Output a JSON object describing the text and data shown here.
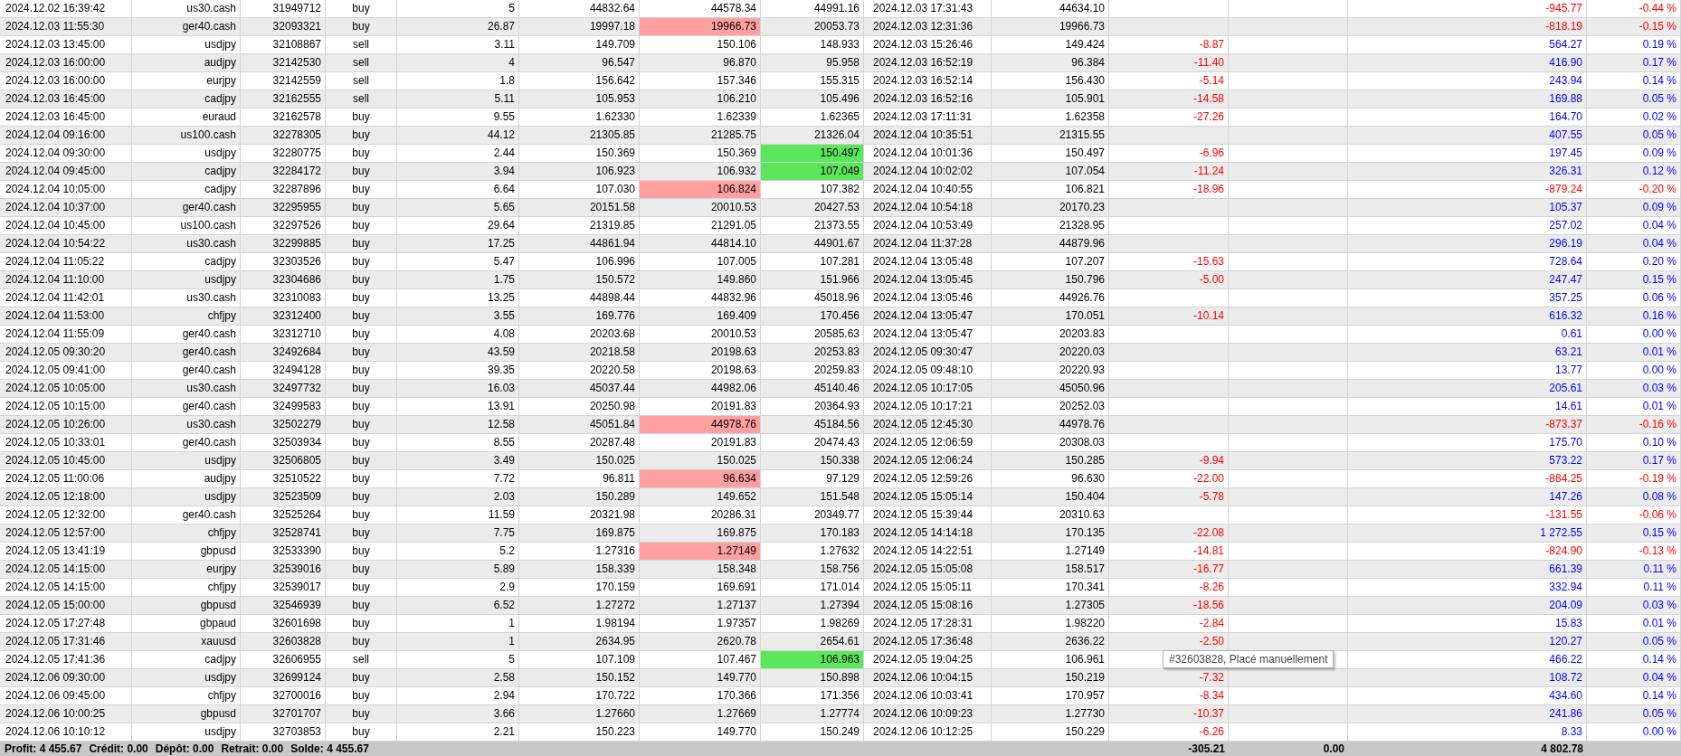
{
  "rows": [
    {
      "time": "2024.12.02 16:39:42",
      "symbol": "us30.cash",
      "ticket": "31949712",
      "type": "buy",
      "volume": "5",
      "price": "44832.64",
      "sl": "44578.34",
      "tp": "44991.16",
      "close_time": "2024.12.03 17:31:43",
      "close_price": "44634.10",
      "profit": "-945.77",
      "percent": "-0.44 %",
      "sl_hit": false,
      "tp_hit": false,
      "loss": true
    },
    {
      "time": "2024.12.03 11:55:30",
      "symbol": "ger40.cash",
      "ticket": "32093321",
      "type": "buy",
      "volume": "26.87",
      "price": "19997.18",
      "sl": "19966.73",
      "tp": "20053.73",
      "close_time": "2024.12.03 12:31:36",
      "close_price": "19966.73",
      "profit": "-818.19",
      "percent": "-0.15 %",
      "sl_hit": true,
      "tp_hit": false,
      "loss": true
    },
    {
      "time": "2024.12.03 13:45:00",
      "symbol": "usdjpy",
      "ticket": "32108867",
      "type": "sell",
      "volume": "3.11",
      "price": "149.709",
      "sl": "150.106",
      "tp": "148.933",
      "close_time": "2024.12.03 15:26:46",
      "close_price": "149.424",
      "commission": "-8.87",
      "profit": "564.27",
      "percent": "0.19 %",
      "sl_hit": false,
      "tp_hit": false,
      "loss": false
    },
    {
      "time": "2024.12.03 16:00:00",
      "symbol": "audjpy",
      "ticket": "32142530",
      "type": "sell",
      "volume": "4",
      "price": "96.547",
      "sl": "96.870",
      "tp": "95.958",
      "close_time": "2024.12.03 16:52:19",
      "close_price": "96.384",
      "commission": "-11.40",
      "profit": "416.90",
      "percent": "0.17 %",
      "sl_hit": false,
      "tp_hit": false,
      "loss": false
    },
    {
      "time": "2024.12.03 16:00:00",
      "symbol": "eurjpy",
      "ticket": "32142559",
      "type": "sell",
      "volume": "1.8",
      "price": "156.642",
      "sl": "157.346",
      "tp": "155.315",
      "close_time": "2024.12.03 16:52:14",
      "close_price": "156.430",
      "commission": "-5.14",
      "profit": "243.94",
      "percent": "0.14 %",
      "sl_hit": false,
      "tp_hit": false,
      "loss": false
    },
    {
      "time": "2024.12.03 16:45:00",
      "symbol": "cadjpy",
      "ticket": "32162555",
      "type": "sell",
      "volume": "5.11",
      "price": "105.953",
      "sl": "106.210",
      "tp": "105.496",
      "close_time": "2024.12.03 16:52:16",
      "close_price": "105.901",
      "commission": "-14.58",
      "profit": "169.88",
      "percent": "0.05 %",
      "sl_hit": false,
      "tp_hit": false,
      "loss": false
    },
    {
      "time": "2024.12.03 16:45:00",
      "symbol": "euraud",
      "ticket": "32162578",
      "type": "buy",
      "volume": "9.55",
      "price": "1.62330",
      "sl": "1.62339",
      "tp": "1.62365",
      "close_time": "2024.12.03 17:11:31",
      "close_price": "1.62358",
      "commission": "-27.26",
      "profit": "164.70",
      "percent": "0.02 %",
      "sl_hit": false,
      "tp_hit": false,
      "loss": false
    },
    {
      "time": "2024.12.04 09:16:00",
      "symbol": "us100.cash",
      "ticket": "32278305",
      "type": "buy",
      "volume": "44.12",
      "price": "21305.85",
      "sl": "21285.75",
      "tp": "21326.04",
      "close_time": "2024.12.04 10:35:51",
      "close_price": "21315.55",
      "profit": "407.55",
      "percent": "0.05 %",
      "sl_hit": false,
      "tp_hit": false,
      "loss": false
    },
    {
      "time": "2024.12.04 09:30:00",
      "symbol": "usdjpy",
      "ticket": "32280775",
      "type": "buy",
      "volume": "2.44",
      "price": "150.369",
      "sl": "150.369",
      "tp": "150.497",
      "close_time": "2024.12.04 10:01:36",
      "close_price": "150.497",
      "commission": "-6.96",
      "profit": "197.45",
      "percent": "0.09 %",
      "sl_hit": false,
      "tp_hit": true,
      "loss": false
    },
    {
      "time": "2024.12.04 09:45:00",
      "symbol": "cadjpy",
      "ticket": "32284172",
      "type": "buy",
      "volume": "3.94",
      "price": "106.923",
      "sl": "106.932",
      "tp": "107.049",
      "close_time": "2024.12.04 10:02:02",
      "close_price": "107.054",
      "commission": "-11.24",
      "profit": "326.31",
      "percent": "0.12 %",
      "sl_hit": false,
      "tp_hit": true,
      "loss": false
    },
    {
      "time": "2024.12.04 10:05:00",
      "symbol": "cadjpy",
      "ticket": "32287896",
      "type": "buy",
      "volume": "6.64",
      "price": "107.030",
      "sl": "106.824",
      "tp": "107.382",
      "close_time": "2024.12.04 10:40:55",
      "close_price": "106.821",
      "commission": "-18.96",
      "profit": "-879.24",
      "percent": "-0.20 %",
      "sl_hit": true,
      "tp_hit": false,
      "loss": true
    },
    {
      "time": "2024.12.04 10:37:00",
      "symbol": "ger40.cash",
      "ticket": "32295955",
      "type": "buy",
      "volume": "5.65",
      "price": "20151.58",
      "sl": "20010.53",
      "tp": "20427.53",
      "close_time": "2024.12.04 10:54:18",
      "close_price": "20170.23",
      "profit": "105.37",
      "percent": "0.09 %",
      "sl_hit": false,
      "tp_hit": false,
      "loss": false
    },
    {
      "time": "2024.12.04 10:45:00",
      "symbol": "us100.cash",
      "ticket": "32297526",
      "type": "buy",
      "volume": "29.64",
      "price": "21319.85",
      "sl": "21291.05",
      "tp": "21373.55",
      "close_time": "2024.12.04 10:53:49",
      "close_price": "21328.95",
      "profit": "257.02",
      "percent": "0.04 %",
      "sl_hit": false,
      "tp_hit": false,
      "loss": false
    },
    {
      "time": "2024.12.04 10:54:22",
      "symbol": "us30.cash",
      "ticket": "32299885",
      "type": "buy",
      "volume": "17.25",
      "price": "44861.94",
      "sl": "44814.10",
      "tp": "44901.67",
      "close_time": "2024.12.04 11:37:28",
      "close_price": "44879.96",
      "profit": "296.19",
      "percent": "0.04 %",
      "sl_hit": false,
      "tp_hit": false,
      "loss": false
    },
    {
      "time": "2024.12.04 11:05:22",
      "symbol": "cadjpy",
      "ticket": "32303526",
      "type": "buy",
      "volume": "5.47",
      "price": "106.996",
      "sl": "107.005",
      "tp": "107.281",
      "close_time": "2024.12.04 13:05:48",
      "close_price": "107.207",
      "commission": "-15.63",
      "profit": "728.64",
      "percent": "0.20 %",
      "sl_hit": false,
      "tp_hit": false,
      "loss": false
    },
    {
      "time": "2024.12.04 11:10:00",
      "symbol": "usdjpy",
      "ticket": "32304686",
      "type": "buy",
      "volume": "1.75",
      "price": "150.572",
      "sl": "149.860",
      "tp": "151.966",
      "close_time": "2024.12.04 13:05:45",
      "close_price": "150.796",
      "commission": "-5.00",
      "profit": "247.47",
      "percent": "0.15 %",
      "sl_hit": false,
      "tp_hit": false,
      "loss": false
    },
    {
      "time": "2024.12.04 11:42:01",
      "symbol": "us30.cash",
      "ticket": "32310083",
      "type": "buy",
      "volume": "13.25",
      "price": "44898.44",
      "sl": "44832.96",
      "tp": "45018.96",
      "close_time": "2024.12.04 13:05:46",
      "close_price": "44926.76",
      "profit": "357.25",
      "percent": "0.06 %",
      "sl_hit": false,
      "tp_hit": false,
      "loss": false
    },
    {
      "time": "2024.12.04 11:53:00",
      "symbol": "chfjpy",
      "ticket": "32312400",
      "type": "buy",
      "volume": "3.55",
      "price": "169.776",
      "sl": "169.409",
      "tp": "170.456",
      "close_time": "2024.12.04 13:05:47",
      "close_price": "170.051",
      "commission": "-10.14",
      "profit": "616.32",
      "percent": "0.16 %",
      "sl_hit": false,
      "tp_hit": false,
      "loss": false
    },
    {
      "time": "2024.12.04 11:55:09",
      "symbol": "ger40.cash",
      "ticket": "32312710",
      "type": "buy",
      "volume": "4.08",
      "price": "20203.68",
      "sl": "20010.53",
      "tp": "20585.63",
      "close_time": "2024.12.04 13:05:47",
      "close_price": "20203.83",
      "profit": "0.61",
      "percent": "0.00 %",
      "sl_hit": false,
      "tp_hit": false,
      "loss": false
    },
    {
      "time": "2024.12.05 09:30:20",
      "symbol": "ger40.cash",
      "ticket": "32492684",
      "type": "buy",
      "volume": "43.59",
      "price": "20218.58",
      "sl": "20198.63",
      "tp": "20253.83",
      "close_time": "2024.12.05 09:30:47",
      "close_price": "20220.03",
      "profit": "63.21",
      "percent": "0.01 %",
      "sl_hit": false,
      "tp_hit": false,
      "loss": false
    },
    {
      "time": "2024.12.05 09:41:00",
      "symbol": "ger40.cash",
      "ticket": "32494128",
      "type": "buy",
      "volume": "39.35",
      "price": "20220.58",
      "sl": "20198.63",
      "tp": "20259.83",
      "close_time": "2024.12.05 09:48:10",
      "close_price": "20220.93",
      "profit": "13.77",
      "percent": "0.00 %",
      "sl_hit": false,
      "tp_hit": false,
      "loss": false
    },
    {
      "time": "2024.12.05 10:05:00",
      "symbol": "us30.cash",
      "ticket": "32497732",
      "type": "buy",
      "volume": "16.03",
      "price": "45037.44",
      "sl": "44982.06",
      "tp": "45140.46",
      "close_time": "2024.12.05 10:17:05",
      "close_price": "45050.96",
      "profit": "205.61",
      "percent": "0.03 %",
      "sl_hit": false,
      "tp_hit": false,
      "loss": false
    },
    {
      "time": "2024.12.05 10:15:00",
      "symbol": "ger40.cash",
      "ticket": "32499583",
      "type": "buy",
      "volume": "13.91",
      "price": "20250.98",
      "sl": "20191.83",
      "tp": "20364.93",
      "close_time": "2024.12.05 10:17:21",
      "close_price": "20252.03",
      "profit": "14.61",
      "percent": "0.01 %",
      "sl_hit": false,
      "tp_hit": false,
      "loss": false
    },
    {
      "time": "2024.12.05 10:26:00",
      "symbol": "us30.cash",
      "ticket": "32502279",
      "type": "buy",
      "volume": "12.58",
      "price": "45051.84",
      "sl": "44978.76",
      "tp": "45184.56",
      "close_time": "2024.12.05 12:45:30",
      "close_price": "44978.76",
      "profit": "-873.37",
      "percent": "-0.16 %",
      "sl_hit": true,
      "tp_hit": false,
      "loss": true
    },
    {
      "time": "2024.12.05 10:33:01",
      "symbol": "ger40.cash",
      "ticket": "32503934",
      "type": "buy",
      "volume": "8.55",
      "price": "20287.48",
      "sl": "20191.83",
      "tp": "20474.43",
      "close_time": "2024.12.05 12:06:59",
      "close_price": "20308.03",
      "profit": "175.70",
      "percent": "0.10 %",
      "sl_hit": false,
      "tp_hit": false,
      "loss": false
    },
    {
      "time": "2024.12.05 10:45:00",
      "symbol": "usdjpy",
      "ticket": "32506805",
      "type": "buy",
      "volume": "3.49",
      "price": "150.025",
      "sl": "150.025",
      "tp": "150.338",
      "close_time": "2024.12.05 12:06:24",
      "close_price": "150.285",
      "commission": "-9.94",
      "profit": "573.22",
      "percent": "0.17 %",
      "sl_hit": false,
      "tp_hit": false,
      "loss": false
    },
    {
      "time": "2024.12.05 11:00:06",
      "symbol": "audjpy",
      "ticket": "32510522",
      "type": "buy",
      "volume": "7.72",
      "price": "96.811",
      "sl": "96.634",
      "tp": "97.129",
      "close_time": "2024.12.05 12:59:26",
      "close_price": "96.630",
      "commission": "-22.00",
      "profit": "-884.25",
      "percent": "-0.19 %",
      "sl_hit": true,
      "tp_hit": false,
      "loss": true
    },
    {
      "time": "2024.12.05 12:18:00",
      "symbol": "usdjpy",
      "ticket": "32523509",
      "type": "buy",
      "volume": "2.03",
      "price": "150.289",
      "sl": "149.652",
      "tp": "151.548",
      "close_time": "2024.12.05 15:05:14",
      "close_price": "150.404",
      "commission": "-5.78",
      "profit": "147.26",
      "percent": "0.08 %",
      "sl_hit": false,
      "tp_hit": false,
      "loss": false
    },
    {
      "time": "2024.12.05 12:32:00",
      "symbol": "ger40.cash",
      "ticket": "32525264",
      "type": "buy",
      "volume": "11.59",
      "price": "20321.98",
      "sl": "20286.31",
      "tp": "20349.77",
      "close_time": "2024.12.05 15:39:44",
      "close_price": "20310.63",
      "profit": "-131.55",
      "percent": "-0.06 %",
      "sl_hit": false,
      "tp_hit": false,
      "loss": true
    },
    {
      "time": "2024.12.05 12:57:00",
      "symbol": "chfjpy",
      "ticket": "32528741",
      "type": "buy",
      "volume": "7.75",
      "price": "169.875",
      "sl": "169.875",
      "tp": "170.183",
      "close_time": "2024.12.05 14:14:18",
      "close_price": "170.135",
      "commission": "-22.08",
      "profit": "1 272.55",
      "percent": "0.15 %",
      "sl_hit": false,
      "tp_hit": false,
      "loss": false
    },
    {
      "time": "2024.12.05 13:41:19",
      "symbol": "gbpusd",
      "ticket": "32533390",
      "type": "buy",
      "volume": "5.2",
      "price": "1.27316",
      "sl": "1.27149",
      "tp": "1.27632",
      "close_time": "2024.12.05 14:22:51",
      "close_price": "1.27149",
      "commission": "-14.81",
      "profit": "-824.90",
      "percent": "-0.13 %",
      "sl_hit": true,
      "tp_hit": false,
      "loss": true
    },
    {
      "time": "2024.12.05 14:15:00",
      "symbol": "eurjpy",
      "ticket": "32539016",
      "type": "buy",
      "volume": "5.89",
      "price": "158.339",
      "sl": "158.348",
      "tp": "158.756",
      "close_time": "2024.12.05 15:05:08",
      "close_price": "158.517",
      "commission": "-16.77",
      "profit": "661.39",
      "percent": "0.11 %",
      "sl_hit": false,
      "tp_hit": false,
      "loss": false
    },
    {
      "time": "2024.12.05 14:15:00",
      "symbol": "chfjpy",
      "ticket": "32539017",
      "type": "buy",
      "volume": "2.9",
      "price": "170.159",
      "sl": "169.691",
      "tp": "171.014",
      "close_time": "2024.12.05 15:05:11",
      "close_price": "170.341",
      "commission": "-8.26",
      "profit": "332.94",
      "percent": "0.11 %",
      "sl_hit": false,
      "tp_hit": false,
      "loss": false
    },
    {
      "time": "2024.12.05 15:00:00",
      "symbol": "gbpusd",
      "ticket": "32546939",
      "type": "buy",
      "volume": "6.52",
      "price": "1.27272",
      "sl": "1.27137",
      "tp": "1.27394",
      "close_time": "2024.12.05 15:08:16",
      "close_price": "1.27305",
      "commission": "-18.56",
      "profit": "204.09",
      "percent": "0.03 %",
      "sl_hit": false,
      "tp_hit": false,
      "loss": false
    },
    {
      "time": "2024.12.05 17:27:48",
      "symbol": "gbpaud",
      "ticket": "32601698",
      "type": "buy",
      "volume": "1",
      "price": "1.98194",
      "sl": "1.97357",
      "tp": "1.98269",
      "close_time": "2024.12.05 17:28:31",
      "close_price": "1.98220",
      "commission": "-2.84",
      "profit": "15.83",
      "percent": "0.01 %",
      "sl_hit": false,
      "tp_hit": false,
      "loss": false
    },
    {
      "time": "2024.12.05 17:31:46",
      "symbol": "xauusd",
      "ticket": "32603828",
      "type": "buy",
      "volume": "1",
      "price": "2634.95",
      "sl": "2620.78",
      "tp": "2654.61",
      "close_time": "2024.12.05 17:36:48",
      "close_price": "2636.22",
      "commission": "-2.50",
      "profit": "120.27",
      "percent": "0.05 %",
      "sl_hit": false,
      "tp_hit": false,
      "loss": false
    },
    {
      "time": "2024.12.05 17:41:36",
      "symbol": "cadjpy",
      "ticket": "32606955",
      "type": "sell",
      "volume": "5",
      "price": "107.109",
      "sl": "107.467",
      "tp": "106.963",
      "close_time": "2024.12.05 19:04:25",
      "close_price": "106.961",
      "profit": "466.22",
      "percent": "0.14 %",
      "sl_hit": false,
      "tp_hit": true,
      "loss": false
    },
    {
      "time": "2024.12.06 09:30:00",
      "symbol": "usdjpy",
      "ticket": "32699124",
      "type": "buy",
      "volume": "2.58",
      "price": "150.152",
      "sl": "149.770",
      "tp": "150.898",
      "close_time": "2024.12.06 10:04:15",
      "close_price": "150.219",
      "commission": "-7.32",
      "profit": "108.72",
      "percent": "0.04 %",
      "sl_hit": false,
      "tp_hit": false,
      "loss": false
    },
    {
      "time": "2024.12.06 09:45:00",
      "symbol": "chfjpy",
      "ticket": "32700016",
      "type": "buy",
      "volume": "2.94",
      "price": "170.722",
      "sl": "170.366",
      "tp": "171.356",
      "close_time": "2024.12.06 10:03:41",
      "close_price": "170.957",
      "commission": "-8.34",
      "profit": "434.60",
      "percent": "0.14 %",
      "sl_hit": false,
      "tp_hit": false,
      "loss": false
    },
    {
      "time": "2024.12.06 10:00:25",
      "symbol": "gbpusd",
      "ticket": "32701707",
      "type": "buy",
      "volume": "3.66",
      "price": "1.27660",
      "sl": "1.27669",
      "tp": "1.27774",
      "close_time": "2024.12.06 10:09:23",
      "close_price": "1.27730",
      "commission": "-10.37",
      "profit": "241.86",
      "percent": "0.05 %",
      "sl_hit": false,
      "tp_hit": false,
      "loss": false
    },
    {
      "time": "2024.12.06 10:10:12",
      "symbol": "usdjpy",
      "ticket": "32703853",
      "type": "buy",
      "volume": "2.21",
      "price": "150.223",
      "sl": "149.770",
      "tp": "150.249",
      "close_time": "2024.12.06 10:12:25",
      "close_price": "150.229",
      "commission": "-6.26",
      "profit": "8.33",
      "percent": "0.00 %",
      "sl_hit": false,
      "tp_hit": false,
      "loss": false
    }
  ],
  "summary": {
    "items": [
      "Profit: 4 455.67",
      "Crédit: 0.00",
      "Dépôt: 0.00",
      "Retrait: 0.00",
      "Solde: 4 455.67"
    ],
    "commission": "-305.21",
    "swap": "0.00",
    "profit": "4 802.78"
  },
  "tooltip": {
    "text": "#32603828, Placé manuellement"
  }
}
